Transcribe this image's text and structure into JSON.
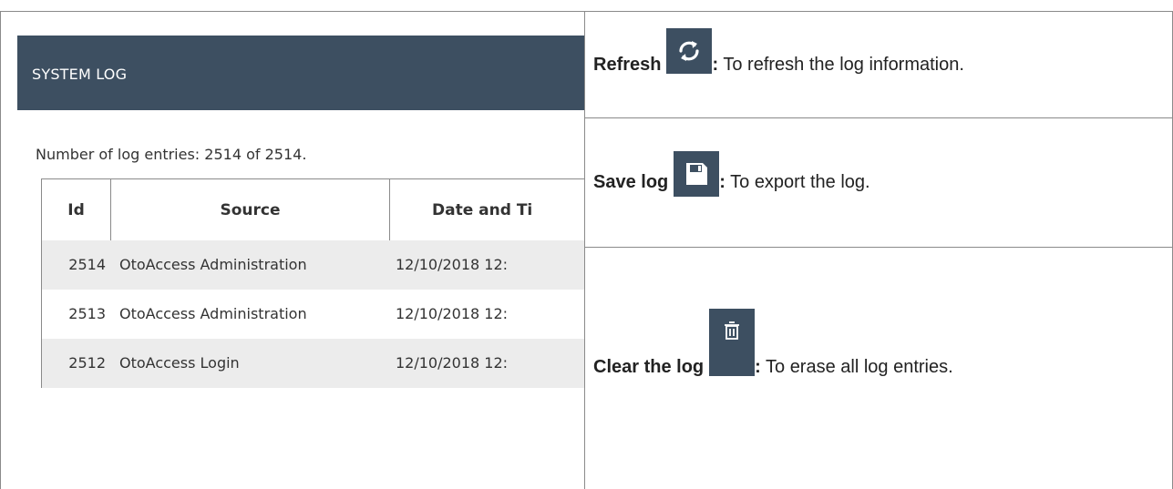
{
  "screenshot_panel": {
    "title": "SYSTEM LOG",
    "log_count_text": "Number of log entries: 2514 of 2514.",
    "columns": [
      "Id",
      "Source",
      "Date and Ti"
    ],
    "rows": [
      {
        "id": "2514",
        "source": "OtoAccess Administration",
        "datetime": "12/10/2018 12:"
      },
      {
        "id": "2513",
        "source": "OtoAccess Administration",
        "datetime": "12/10/2018 12:"
      },
      {
        "id": "2512",
        "source": "OtoAccess Login",
        "datetime": "12/10/2018 12:"
      }
    ],
    "header_color": "#3d4f61",
    "row_shade_color": "#ececec"
  },
  "descriptions": [
    {
      "label": "Refresh",
      "icon": "refresh-icon",
      "colon": ":",
      "text": " To refresh the log information."
    },
    {
      "label": "Save log",
      "icon": "save-icon",
      "colon": ":",
      "text": " To export the log."
    },
    {
      "label": "Clear the log",
      "icon": "trash-icon",
      "colon": ":",
      "text": " To erase all log entries."
    }
  ]
}
